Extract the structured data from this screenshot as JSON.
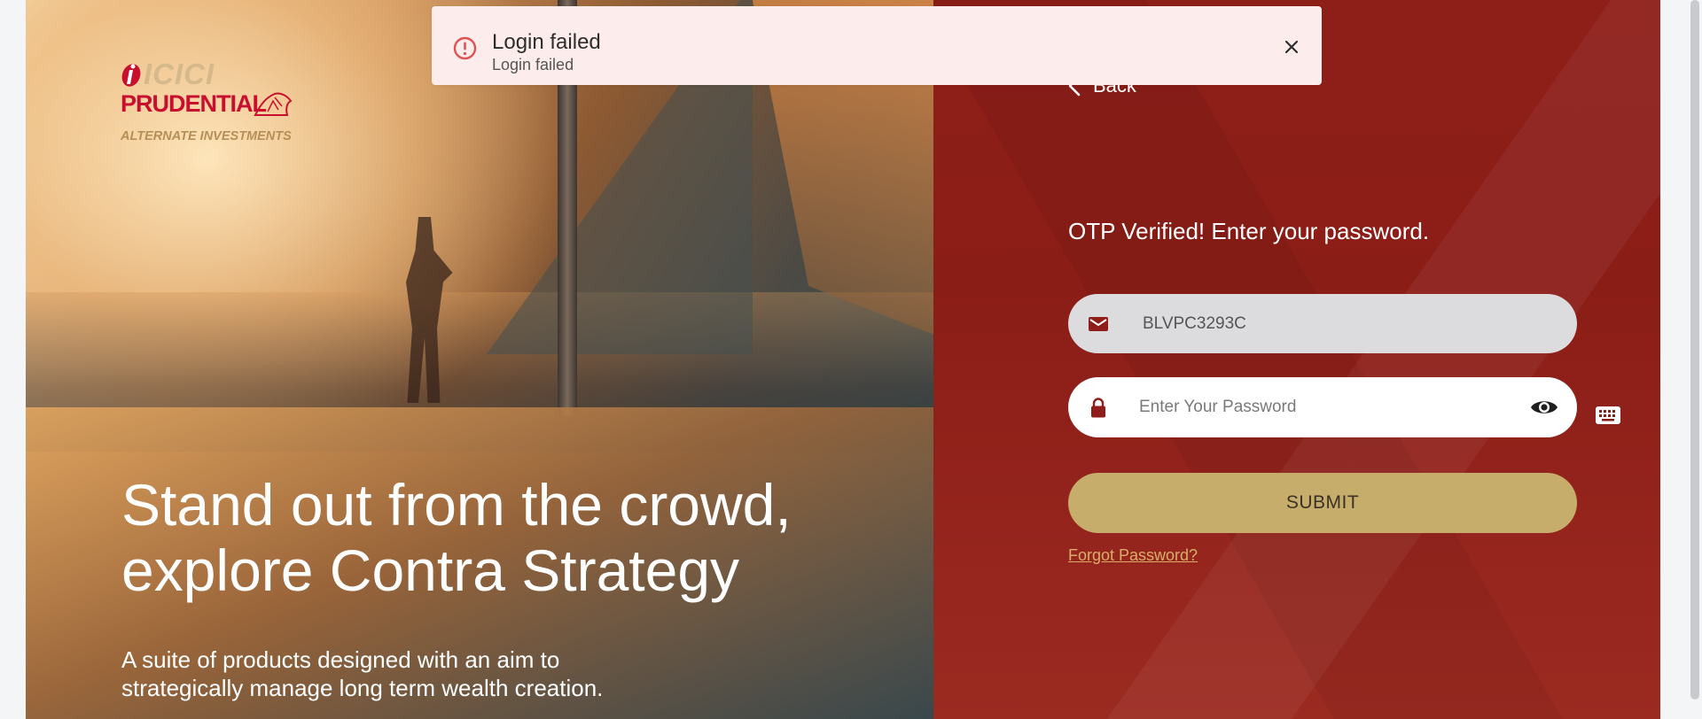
{
  "hero": {
    "brand": {
      "line1": "ICICI",
      "line2": "PRUDENTIAL",
      "line3": "ALTERNATE INVESTMENTS"
    },
    "headline_line1": "Stand out from the crowd,",
    "headline_line2": "explore Contra Strategy",
    "sub_line1": "A suite of products designed with an aim to",
    "sub_line2": "strategically manage long term wealth creation."
  },
  "form": {
    "back_label": "Back",
    "title": "OTP Verified! Enter your password.",
    "username_value": "BLVPC3293C",
    "password_placeholder": "Enter Your Password",
    "submit_label": "SUBMIT",
    "forgot_label": "Forgot Password?"
  },
  "toast": {
    "title": "Login failed",
    "message": "Login failed"
  },
  "colors": {
    "panel_red": "#8b1d17",
    "gold": "#c6ad6b",
    "forgot_link": "#d8ae6a",
    "toast_bg": "#fdecec",
    "toast_icon": "#e05252"
  },
  "icons": {
    "username": "envelope-icon",
    "password": "lock-icon",
    "visibility": "eye-icon",
    "keyboard": "keyboard-icon",
    "toast_status": "alert-circle-icon",
    "toast_close": "close-icon",
    "back": "chevron-left-icon"
  }
}
